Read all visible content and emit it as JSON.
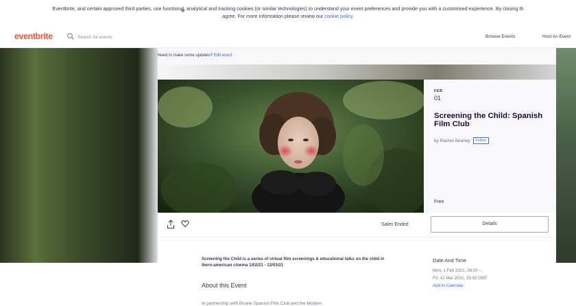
{
  "cookie": {
    "text_before": "Eventbrite, and certain approved third parties, use functional, analytical and tracking cookies (or similar technologies) to understand your event preferences and provide you with a customised experience. By closing th",
    "line2_before": "agree. For more information please review our ",
    "policy_link": "cookie policy",
    "line2_after": "."
  },
  "nav": {
    "logo": "eventbrite",
    "search_placeholder": "Search for events",
    "browse": "Browse Events",
    "host": "Host An Event"
  },
  "update_bar": {
    "text": "Need to make some updates? ",
    "link": "Edit event"
  },
  "event": {
    "month": "FEB",
    "day": "01",
    "title": "Screening the Child: Spanish Film Club",
    "by": "by Rachel Beaney",
    "follow": "Follow",
    "price": "Free",
    "sales_status": "Sales Ended",
    "details_button": "Details",
    "summary": "Screening the Child is a series of virtual film screenings & educational talks on the child in Ibero-american cinema 1/02/21 - 12/03/21",
    "about_heading": "About this Event",
    "body_preview": "In partnership with Bruele Spanish Film Club and the Modern",
    "date_time_heading": "Date And Time",
    "date_line1": "Mon, 1 Feb 2021, 08:00 –",
    "date_line2": "Fri, 12 Mar 2021, 23:30 GMT",
    "add_calendar": "Add to Calendar"
  },
  "colors": {
    "brand": "#f05537",
    "link": "#3d64ff",
    "text_dark": "#1e0a3c"
  },
  "icons": [
    "search-icon",
    "share-icon",
    "heart-icon"
  ]
}
